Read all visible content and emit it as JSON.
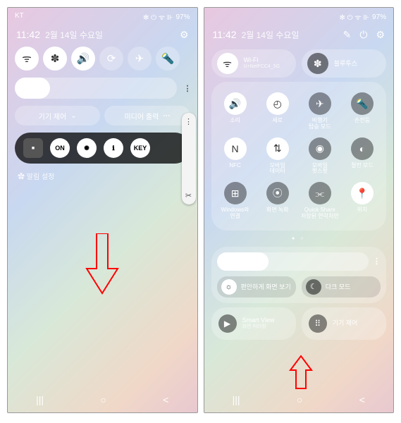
{
  "status": {
    "carrier": "KT",
    "icons": "✻ ⏻ ᯤ ⊪",
    "battery": "97%"
  },
  "date_row": {
    "time": "11:42",
    "date": "2월 14일 수요일"
  },
  "panel1": {
    "qs": [
      {
        "name": "wifi",
        "glyph": "ᯤ",
        "on": true
      },
      {
        "name": "bluetooth",
        "glyph": "✽",
        "on": true
      },
      {
        "name": "sound",
        "glyph": "🔊",
        "on": true
      },
      {
        "name": "rotate",
        "glyph": "⟳",
        "on": false
      },
      {
        "name": "airplane",
        "glyph": "✈",
        "on": false
      },
      {
        "name": "flashlight",
        "glyph": "🔦",
        "on": false
      }
    ],
    "pill_left": "기기 제어",
    "pill_right": "미디어 출력",
    "ext": [
      {
        "label": "■",
        "sq": true
      },
      {
        "label": "ON"
      },
      {
        "label": "✺"
      },
      {
        "label": "ℹ"
      },
      {
        "label": "KEY"
      }
    ],
    "notif": "✿ 알림 설정",
    "side_top": "⋮",
    "side_bot": "✂"
  },
  "panel2": {
    "top": [
      {
        "name": "wifi",
        "glyph": "ᯤ",
        "title": "Wi-Fi",
        "sub": "U+NetFCC4_5G",
        "on": true
      },
      {
        "name": "bluetooth",
        "glyph": "✽",
        "title": "블루투스",
        "sub": "",
        "on": false
      }
    ],
    "grid": [
      [
        {
          "name": "sound",
          "glyph": "🔊",
          "label": "소리",
          "on": true
        },
        {
          "name": "power-saving",
          "glyph": "◴",
          "label": "세로",
          "on": true
        },
        {
          "name": "airplane",
          "glyph": "✈",
          "label": "비행기\n탑승 모드",
          "on": false
        },
        {
          "name": "flashlight",
          "glyph": "🔦",
          "label": "손전등",
          "on": false
        }
      ],
      [
        {
          "name": "nfc",
          "glyph": "N",
          "label": "NFC",
          "on": true
        },
        {
          "name": "mobile-data",
          "glyph": "⇅",
          "label": "모바일\n데이터",
          "on": true
        },
        {
          "name": "hotspot",
          "glyph": "◉",
          "label": "모바일\n핫스팟",
          "on": false
        },
        {
          "name": "battery-saver",
          "glyph": "◐",
          "label": "절전 모드",
          "on": false
        }
      ],
      [
        {
          "name": "windows-link",
          "glyph": "⊞",
          "label": "Windows와\n연결",
          "on": false
        },
        {
          "name": "screen-record",
          "glyph": "⦿",
          "label": "화면 녹화",
          "on": false
        },
        {
          "name": "quick-share",
          "glyph": "⫘",
          "label": "Quick Share\n저장된 연락처만",
          "on": false
        },
        {
          "name": "location",
          "glyph": "📍",
          "label": "위치",
          "on": true
        }
      ]
    ],
    "dots": "● ○",
    "eye_comfort": "편안하게 화면 보기",
    "dark_mode": "다크 모드",
    "bottom": [
      {
        "name": "smart-view",
        "glyph": "▶",
        "title": "Smart View",
        "sub": "화면 미러링"
      },
      {
        "name": "device-control",
        "glyph": "⠿",
        "title": "기기 제어",
        "sub": ""
      }
    ]
  },
  "nav": {
    "recent": "|||",
    "home": "○",
    "back": "<"
  }
}
